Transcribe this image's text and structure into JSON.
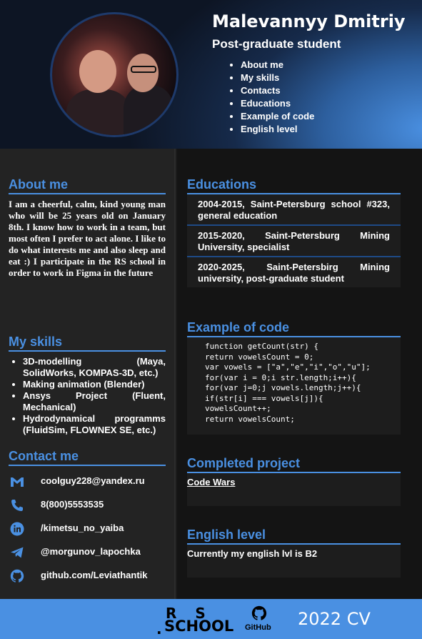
{
  "header": {
    "name": "Malevannyy Dmitriy",
    "subtitle": "Post-graduate student",
    "nav": [
      "About me",
      "My skills",
      "Contacts",
      "Educations",
      "Example of code",
      "English level"
    ]
  },
  "about": {
    "title": "About me",
    "text": "I am a cheerful, calm, kind young man who will be 25 years old on January 8th. I know how to work in a team, but most often I prefer to act alone. I like to do what interests me and also sleep and eat :) I participate in the RS school in order to work in Figma in the future"
  },
  "skills": {
    "title": "My skills",
    "items": [
      "3D-modelling (Maya, SolidWorks, KOMPAS-3D, etc.)",
      "Making animation (Blender)",
      "Ansys Project (Fluent, Mechanical)",
      "Hydrodynamical programms (FluidSim, FLOWNEX SE, etc.)"
    ]
  },
  "contacts": {
    "title": "Contact me",
    "items": [
      {
        "icon": "gmail-icon",
        "text": "coolguy228@yandex.ru"
      },
      {
        "icon": "phone-icon",
        "text": "8(800)5553535"
      },
      {
        "icon": "linkedin-icon",
        "text": "/kimetsu_no_yaiba"
      },
      {
        "icon": "telegram-icon",
        "text": "@morgunov_lapochka"
      },
      {
        "icon": "github-icon",
        "text": "github.com/Leviathantik"
      }
    ]
  },
  "educations": {
    "title": "Educations",
    "items": [
      "2004-2015, Saint-Petersburg school #323, general education",
      "2015-2020, Saint-Petersburg Mining University, specialist",
      "2020-2025, Saint-Petersbirg Mining university, post-graduate student"
    ]
  },
  "code": {
    "title": "Example of code",
    "lines": [
      "function getCount(str) {",
      "return vowelsCount = 0;",
      "var vowels = [\"a\",\"e\",\"i\",\"o\",\"u\"];",
      "for(var i = 0;i str.length;i++){",
      "for(var j=0;j vowels.length;j++){",
      "if(str[i] === vowels[j]){",
      "vowelsCount++;",
      "return vowelsCount;"
    ]
  },
  "project": {
    "title": "Completed project",
    "link": "Code Wars"
  },
  "english": {
    "title": "English level",
    "text": "Currently my english lvl is B2"
  },
  "footer": {
    "rs_top": "RS",
    "rs_dot": ".",
    "rs_bottom": "SCHOOL",
    "github_label": "GitHub",
    "year": "2022 CV"
  },
  "colors": {
    "accent": "#4a90e2",
    "sidebar_bg": "#232323",
    "main_bg": "#141414",
    "text": "#ffffff"
  }
}
